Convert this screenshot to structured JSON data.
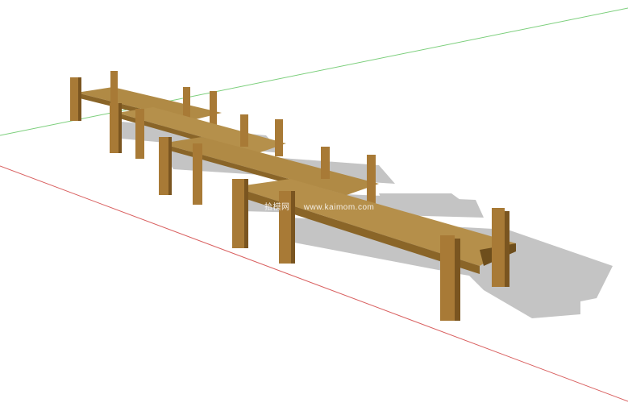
{
  "scene": {
    "subject": "wooden-boardwalk-3d-model",
    "colors": {
      "background": "#ffffff",
      "green_axis": "#7ccf7c",
      "red_axis": "#d96060",
      "shadow": "#bdbdbd",
      "wood_top": "#b08a45",
      "wood_side": "#8a6528",
      "wood_dark": "#6e4e1c",
      "post_front": "#a87a36",
      "post_side": "#7a5520"
    }
  },
  "watermark": {
    "site_name": "拾模网",
    "url": "www.kaimom.com"
  }
}
